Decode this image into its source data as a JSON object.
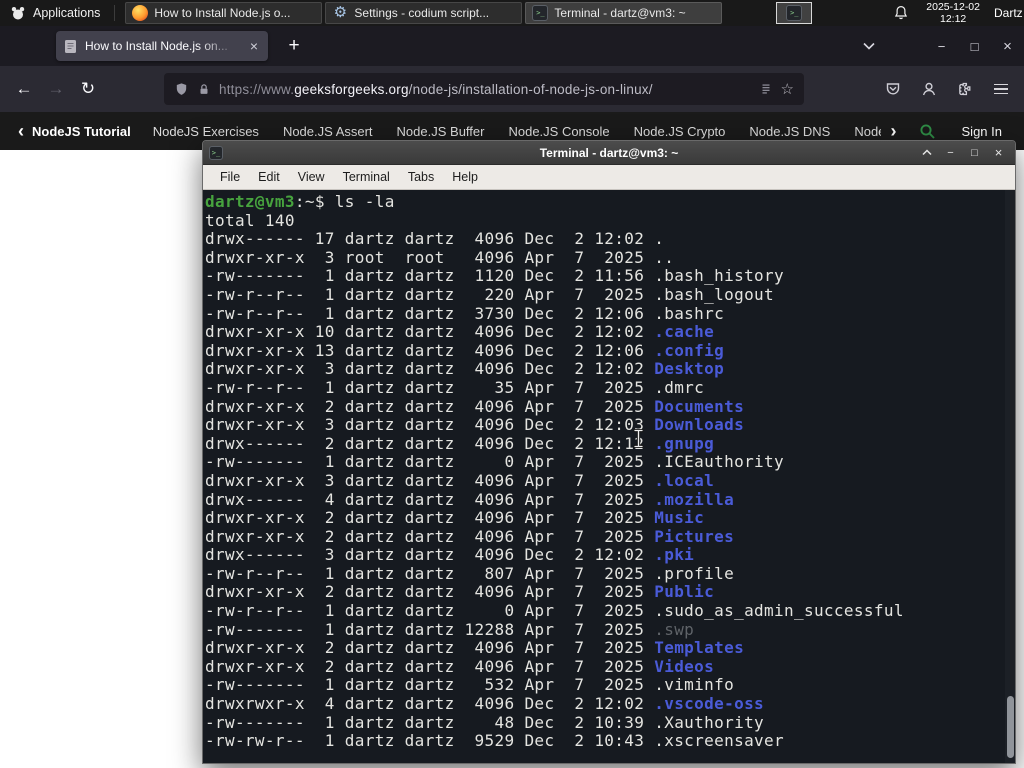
{
  "colors": {
    "panel_bg": "#191919",
    "firefox_orange": "#ff9a2e",
    "gfg_green": "#2f8d46",
    "terminal_bg": "#161a20",
    "prompt_green": "#47a33e",
    "directory_blue": "#4a5bd8",
    "dim_grey": "#5f6368"
  },
  "panel": {
    "applications_label": "Applications",
    "tasks": [
      {
        "icon": "firefox",
        "label": "How to Install Node.js o...",
        "active": false
      },
      {
        "icon": "settings",
        "label": "Settings - codium script...",
        "active": false
      },
      {
        "icon": "terminal",
        "label": "Terminal - dartz@vm3: ~",
        "active": true
      }
    ],
    "clock": {
      "date": "2025-12-02",
      "time": "12:12"
    },
    "user": "Dartz"
  },
  "browser": {
    "tab_title": "How to Install Node.js on...",
    "new_tab_label": "+",
    "url_protocol": "https://www.",
    "url_domain": "geeksforgeeks.org",
    "url_path": "/node-js/installation-of-node-js-on-linux/",
    "controls": {
      "minimize": "−",
      "maximize": "□",
      "close": "×"
    }
  },
  "site_nav": {
    "active_item": "NodeJS Tutorial",
    "items": [
      "NodeJS Exercises",
      "Node.JS Assert",
      "Node.JS Buffer",
      "Node.JS Console",
      "Node.JS Crypto",
      "Node.JS DNS",
      "Node..."
    ],
    "sign_in_label": "Sign In"
  },
  "terminal": {
    "window_title": "Terminal - dartz@vm3: ~",
    "menu_items": [
      "File",
      "Edit",
      "View",
      "Terminal",
      "Tabs",
      "Help"
    ],
    "controls": {
      "shade": "^",
      "minimize": "−",
      "maximize": "□",
      "close": "×"
    },
    "lines": [
      [
        [
          "dartz@vm3",
          "g"
        ],
        [
          ":~$ ls -la",
          "f"
        ]
      ],
      [
        [
          "total 140",
          "f"
        ]
      ],
      [
        [
          "drwx------ 17 dartz dartz  4096 Dec  2 12:02 .",
          "f"
        ]
      ],
      [
        [
          "drwxr-xr-x  3 root  root   4096 Apr  7  2025 ..",
          "f"
        ]
      ],
      [
        [
          "-rw-------  1 dartz dartz  1120 Dec  2 11:56 .bash_history",
          "f"
        ]
      ],
      [
        [
          "-rw-r--r--  1 dartz dartz   220 Apr  7  2025 .bash_logout",
          "f"
        ]
      ],
      [
        [
          "-rw-r--r--  1 dartz dartz  3730 Dec  2 12:06 .bashrc",
          "f"
        ]
      ],
      [
        [
          "drwxr-xr-x 10 dartz dartz  4096 Dec  2 12:02 ",
          "f"
        ],
        [
          ".cache",
          "d"
        ]
      ],
      [
        [
          "drwxr-xr-x 13 dartz dartz  4096 Dec  2 12:06 ",
          "f"
        ],
        [
          ".config",
          "d"
        ]
      ],
      [
        [
          "drwxr-xr-x  3 dartz dartz  4096 Dec  2 12:02 ",
          "f"
        ],
        [
          "Desktop",
          "d"
        ]
      ],
      [
        [
          "-rw-r--r--  1 dartz dartz    35 Apr  7  2025 .dmrc",
          "f"
        ]
      ],
      [
        [
          "drwxr-xr-x  2 dartz dartz  4096 Apr  7  2025 ",
          "f"
        ],
        [
          "Documents",
          "d"
        ]
      ],
      [
        [
          "drwxr-xr-x  3 dartz dartz  4096 Dec  2 12:03 ",
          "f"
        ],
        [
          "Downloads",
          "d"
        ]
      ],
      [
        [
          "drwx------  2 dartz dartz  4096 Dec  2 12:12 ",
          "f"
        ],
        [
          ".gnupg",
          "d"
        ]
      ],
      [
        [
          "-rw-------  1 dartz dartz     0 Apr  7  2025 .ICEauthority",
          "f"
        ]
      ],
      [
        [
          "drwxr-xr-x  3 dartz dartz  4096 Apr  7  2025 ",
          "f"
        ],
        [
          ".local",
          "d"
        ]
      ],
      [
        [
          "drwx------  4 dartz dartz  4096 Apr  7  2025 ",
          "f"
        ],
        [
          ".mozilla",
          "d"
        ]
      ],
      [
        [
          "drwxr-xr-x  2 dartz dartz  4096 Apr  7  2025 ",
          "f"
        ],
        [
          "Music",
          "d"
        ]
      ],
      [
        [
          "drwxr-xr-x  2 dartz dartz  4096 Apr  7  2025 ",
          "f"
        ],
        [
          "Pictures",
          "d"
        ]
      ],
      [
        [
          "drwx------  3 dartz dartz  4096 Dec  2 12:02 ",
          "f"
        ],
        [
          ".pki",
          "d"
        ]
      ],
      [
        [
          "-rw-r--r--  1 dartz dartz   807 Apr  7  2025 .profile",
          "f"
        ]
      ],
      [
        [
          "drwxr-xr-x  2 dartz dartz  4096 Apr  7  2025 ",
          "f"
        ],
        [
          "Public",
          "d"
        ]
      ],
      [
        [
          "-rw-r--r--  1 dartz dartz     0 Apr  7  2025 .sudo_as_admin_successful",
          "f"
        ]
      ],
      [
        [
          "-rw-------  1 dartz dartz 12288 Apr  7  2025 ",
          "f"
        ],
        [
          ".swp",
          "m"
        ]
      ],
      [
        [
          "drwxr-xr-x  2 dartz dartz  4096 Apr  7  2025 ",
          "f"
        ],
        [
          "Templates",
          "d"
        ]
      ],
      [
        [
          "drwxr-xr-x  2 dartz dartz  4096 Apr  7  2025 ",
          "f"
        ],
        [
          "Videos",
          "d"
        ]
      ],
      [
        [
          "-rw-------  1 dartz dartz   532 Apr  7  2025 .viminfo",
          "f"
        ]
      ],
      [
        [
          "drwxrwxr-x  4 dartz dartz  4096 Dec  2 12:02 ",
          "f"
        ],
        [
          ".vscode-oss",
          "d"
        ]
      ],
      [
        [
          "-rw-------  1 dartz dartz    48 Dec  2 10:39 .Xauthority",
          "f"
        ]
      ],
      [
        [
          "-rw-rw-r--  1 dartz dartz  9529 Dec  2 10:43 .xscreensaver",
          "f"
        ]
      ]
    ]
  }
}
